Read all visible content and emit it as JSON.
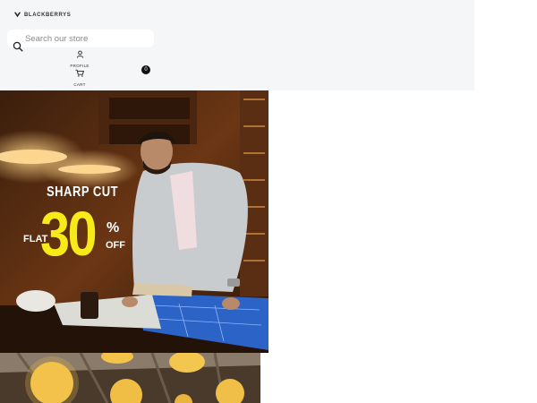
{
  "header": {
    "logo_text": "BLACKBERRYS",
    "search_placeholder": "Search our store",
    "profile_label": "PROFILE",
    "cart_label": "CART",
    "cart_count": "0"
  },
  "banner": {
    "headline": "SHARP CUT",
    "flat": "FLAT",
    "number": "30",
    "percent": "%",
    "off": "OFF"
  }
}
